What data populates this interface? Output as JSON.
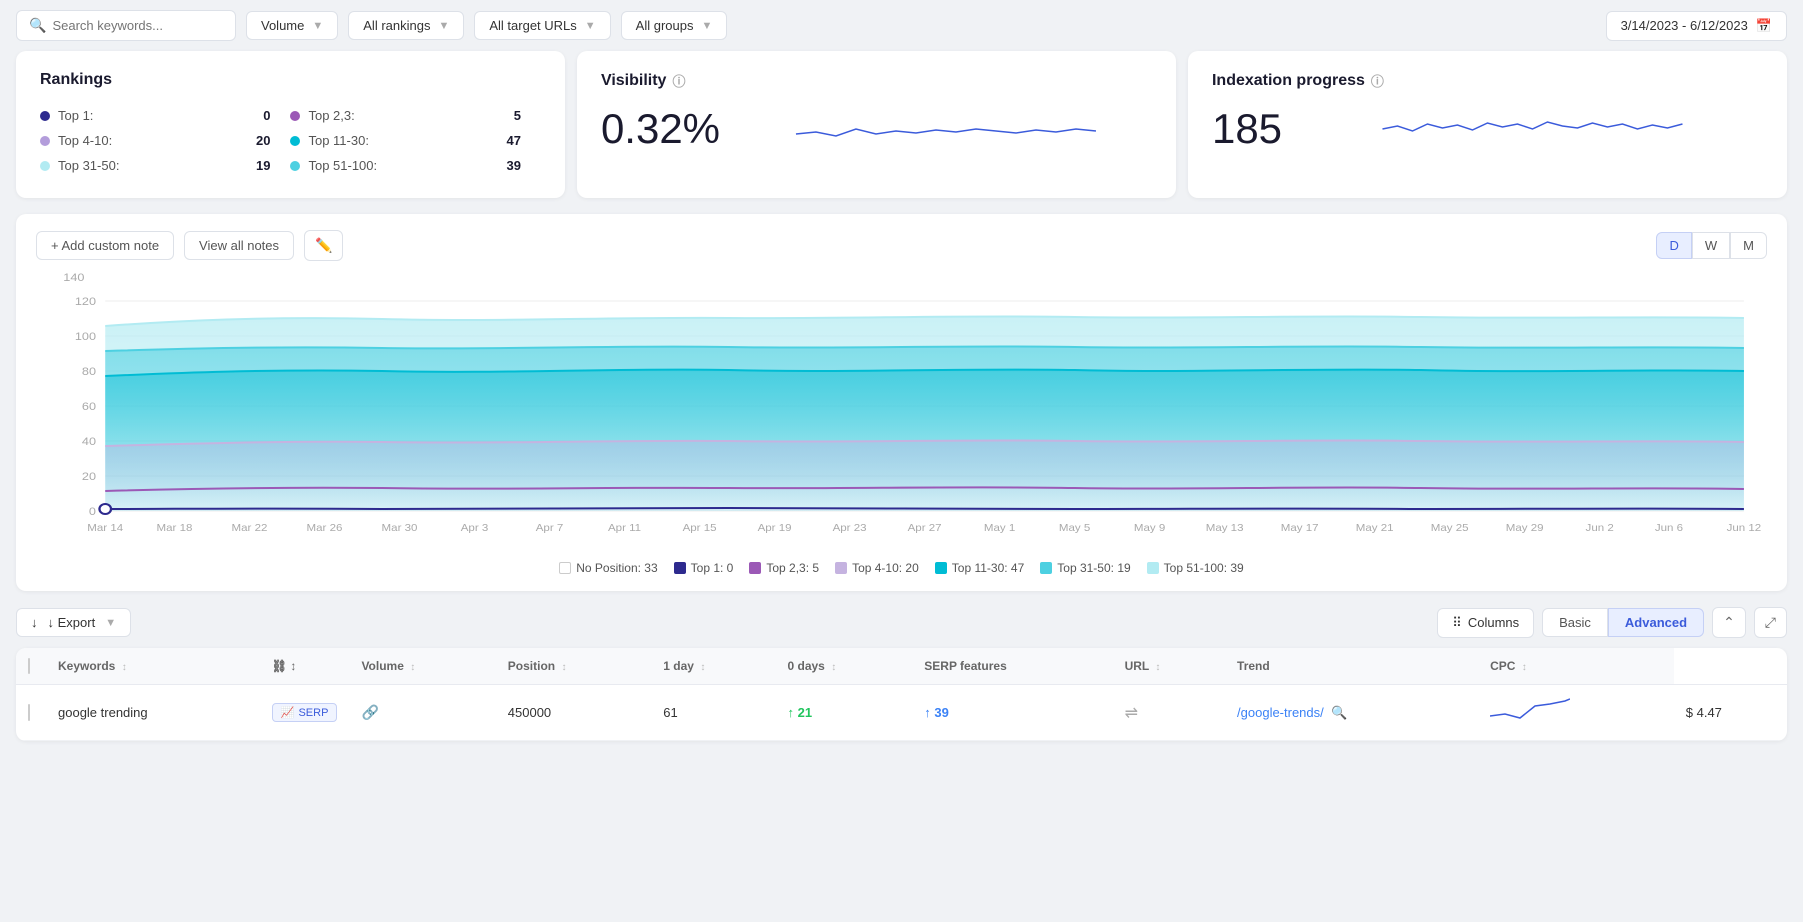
{
  "toolbar": {
    "search_placeholder": "Search keywords...",
    "volume_label": "Volume",
    "rankings_label": "All rankings",
    "urls_label": "All target URLs",
    "groups_label": "All groups",
    "date_range": "3/14/2023 - 6/12/2023"
  },
  "rankings_card": {
    "title": "Rankings",
    "items_left": [
      {
        "label": "Top 1:",
        "value": "0",
        "dot": "navy"
      },
      {
        "label": "Top 4-10:",
        "value": "20",
        "dot": "lavender"
      },
      {
        "label": "Top 31-50:",
        "value": "19",
        "dot": "light-cyan"
      }
    ],
    "items_right": [
      {
        "label": "Top 2,3:",
        "value": "5",
        "dot": "purple"
      },
      {
        "label": "Top 11-30:",
        "value": "47",
        "dot": "cyan"
      },
      {
        "label": "Top 51-100:",
        "value": "39",
        "dot": "teal"
      }
    ]
  },
  "visibility_card": {
    "title": "Visibility",
    "value": "0.32%"
  },
  "indexation_card": {
    "title": "Indexation progress",
    "value": "185"
  },
  "chart": {
    "add_note_label": "+ Add custom note",
    "view_notes_label": "View all notes",
    "period_d": "D",
    "period_w": "W",
    "period_m": "M",
    "active_period": "D",
    "y_labels": [
      "0",
      "20",
      "40",
      "60",
      "80",
      "100",
      "120",
      "140"
    ],
    "x_labels": [
      "Mar 14",
      "Mar 18",
      "Mar 22",
      "Mar 26",
      "Mar 30",
      "Apr 3",
      "Apr 7",
      "Apr 11",
      "Apr 15",
      "Apr 19",
      "Apr 23",
      "Apr 27",
      "May 1",
      "May 5",
      "May 9",
      "May 13",
      "May 17",
      "May 21",
      "May 25",
      "May 29",
      "Jun 2",
      "Jun 6",
      "Jun 12"
    ],
    "legend": [
      {
        "label": "No Position: 33",
        "color": "#fff",
        "border": "#ccc",
        "filled": false
      },
      {
        "label": "Top 1: 0",
        "color": "#2d2a8e",
        "filled": true
      },
      {
        "label": "Top 2,3: 5",
        "color": "#9b59b6",
        "filled": true
      },
      {
        "label": "Top 4-10: 20",
        "color": "#c5b3e0",
        "filled": true
      },
      {
        "label": "Top 11-30: 47",
        "color": "#00bcd4",
        "filled": true
      },
      {
        "label": "Top 31-50: 19",
        "color": "#4dd0e1",
        "filled": true
      },
      {
        "label": "Top 51-100: 39",
        "color": "#b2ebf2",
        "filled": true
      }
    ]
  },
  "table": {
    "export_label": "↓ Export",
    "columns_label": "Columns",
    "basic_label": "Basic",
    "advanced_label": "Advanced",
    "headers": [
      "Keywords",
      "",
      "Volume ↕",
      "Position ↕",
      "1 day ↕",
      "0 days ↕",
      "SERP features",
      "URL ↕",
      "Trend",
      "CPC ↕"
    ],
    "rows": [
      {
        "keyword": "google trending",
        "serp": "SERP",
        "link": true,
        "volume": "450000",
        "position": "61",
        "day1": "21",
        "day1_up": true,
        "days0": "39",
        "days0_up": false,
        "serp_features": "⇌",
        "url": "/google-trends/",
        "cpc": "$ 4.47"
      }
    ]
  }
}
